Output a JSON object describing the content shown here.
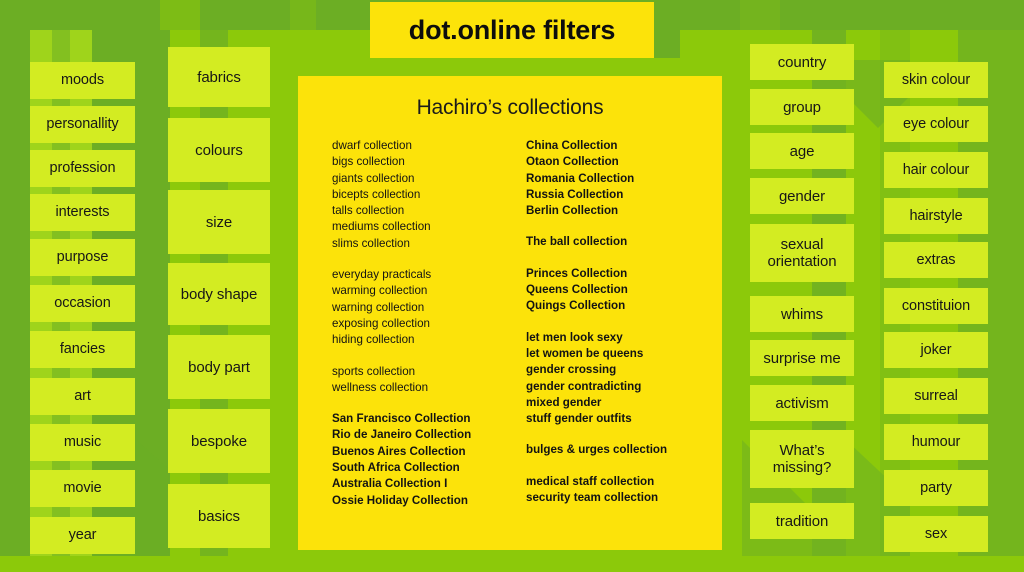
{
  "header": {
    "title": "dot.online filters"
  },
  "panel": {
    "title": "Hachiro’s collections",
    "left_groups": [
      {
        "items": [
          "dwarf collection",
          "bigs collection",
          "giants collection",
          "bicepts collection",
          "talls collection",
          "mediums collection",
          "slims collection"
        ]
      },
      {
        "items": [
          "everyday practicals",
          "warming collection",
          "warning collection",
          "exposing collection",
          "hiding collection"
        ]
      },
      {
        "items": [
          "sports collection",
          "wellness collection"
        ]
      },
      {
        "items": [
          "San Francisco Collection",
          "Rio de Janeiro Collection",
          "Buenos Aires Collection",
          "South Africa Collection",
          "Australia Collection I",
          "Ossie Holiday Collection"
        ]
      }
    ],
    "right_groups": [
      {
        "items": [
          "China Collection",
          "Otaon Collection",
          "Romania Collection",
          "Russia Collection",
          "Berlin Collection"
        ]
      },
      {
        "items": [
          "The ball collection"
        ]
      },
      {
        "items": [
          "Princes Collection",
          "Queens Collection",
          "Quings Collection"
        ]
      },
      {
        "items": [
          "let men look sexy",
          "let women be queens",
          "gender crossing",
          "gender contradicting",
          "mixed gender",
          "stuff gender outfits"
        ]
      },
      {
        "items": [
          "bulges & urges collection"
        ]
      },
      {
        "items": [
          "medical staff collection",
          "security team collection"
        ]
      }
    ]
  },
  "columns": {
    "col1": [
      "moods",
      "personallity",
      "profession",
      "interests",
      "purpose",
      "occasion",
      "fancies",
      "art",
      "music",
      "movie",
      "year"
    ],
    "col2": [
      "fabrics",
      "colours",
      "size",
      "body shape",
      "body part",
      "bespoke",
      "basics"
    ],
    "col3": [
      "country",
      "group",
      "age",
      "gender",
      "sexual orientation",
      "whims",
      "surprise me",
      "activism",
      "What’s missing?",
      "tradition"
    ],
    "col4": [
      "skin colour",
      "eye colour",
      "hair colour",
      "hairstyle",
      "extras",
      "constituion",
      "joker",
      "surreal",
      "humour",
      "party",
      "sex"
    ]
  },
  "colors": {
    "background_green": "#8cc90a",
    "dark_green": "#6cae24",
    "light_green": "#9fd41b",
    "button_green": "#d3ec22",
    "panel_yellow": "#fce30a",
    "text_dark": "#131313"
  }
}
